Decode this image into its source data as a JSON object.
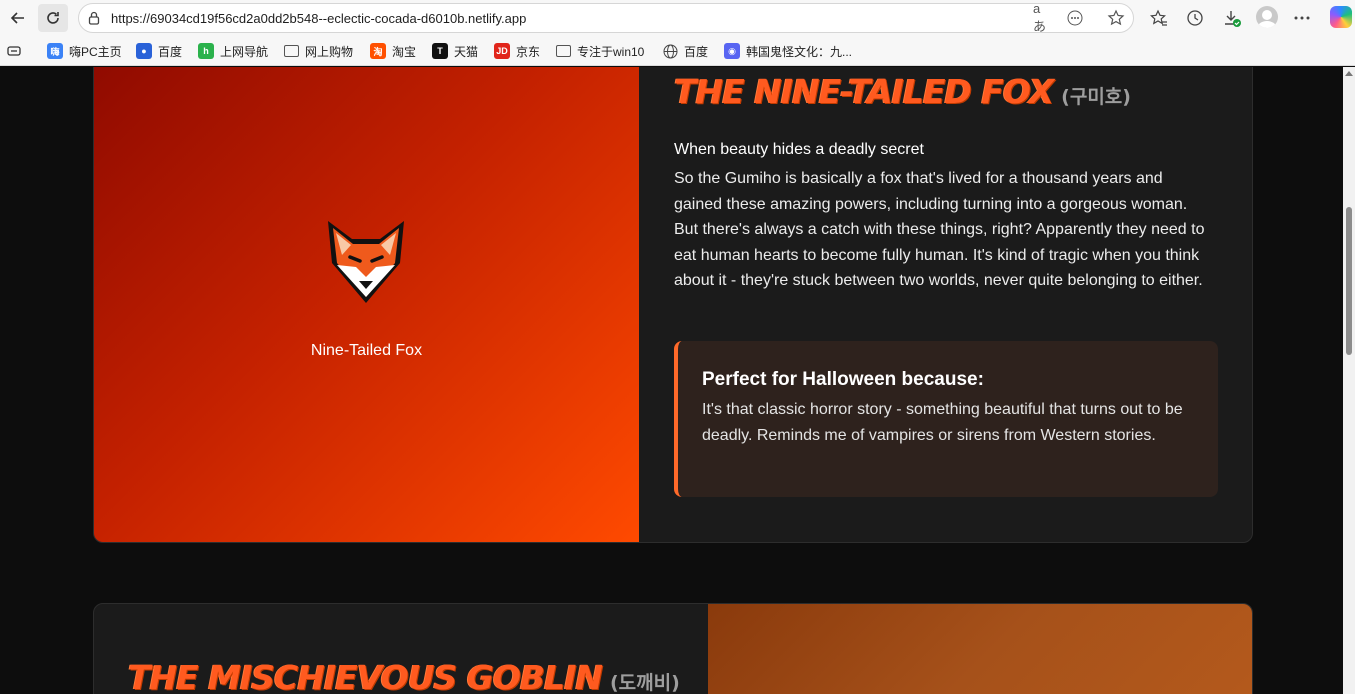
{
  "browser": {
    "url": "https://69034cd19f56cd2a0dd2b548--eclectic-cocada-d6010b.netlify.app",
    "read_aloud_icon": "aあ",
    "bookmarks": [
      {
        "label": "嗨PC主页",
        "icon": "hipc-icon",
        "color": "#3b82f6"
      },
      {
        "label": "百度",
        "icon": "baidu-paw-icon",
        "color": "#2a62d8"
      },
      {
        "label": "上网导航",
        "icon": "hao-icon",
        "color": "#2bb24c"
      },
      {
        "label": "网上购物",
        "icon": "folder-icon"
      },
      {
        "label": "淘宝",
        "icon": "taobao-icon",
        "color": "#ff5000"
      },
      {
        "label": "天猫",
        "icon": "tmall-icon",
        "color": "#d00"
      },
      {
        "label": "京东",
        "icon": "jd-icon",
        "color": "#e1251b"
      },
      {
        "label": "专注于win10",
        "icon": "folder-icon"
      },
      {
        "label": "百度",
        "icon": "globe-icon"
      },
      {
        "label": "韩国鬼怪文化：九...",
        "icon": "discord-like-icon",
        "color": "#5865f2"
      }
    ]
  },
  "card1": {
    "emoji": "🦊",
    "image_caption": "Nine-Tailed Fox",
    "title": "The Nine-Tailed Fox",
    "korean": "(구미호)",
    "tagline": "When beauty hides a deadly secret",
    "description": "So the Gumiho is basically a fox that's lived for a thousand years and gained these amazing powers, including turning into a gorgeous woman. But there's always a catch with these things, right? Apparently they need to eat human hearts to become fully human. It's kind of tragic when you think about it - they're stuck between two worlds, never quite belonging to either.",
    "callout_title": "Perfect for Halloween because:",
    "callout_text": "It's that classic horror story - something beautiful that turns out to be deadly. Reminds me of vampires or sirens from Western stories."
  },
  "card2": {
    "title": "The Mischievous Goblin",
    "korean": "(도깨비)"
  },
  "colors": {
    "accent": "#ff5a1f",
    "page_bg": "#0d0d0d",
    "card_bg": "#1b1b1b",
    "callout_bg": "#2e221d"
  }
}
